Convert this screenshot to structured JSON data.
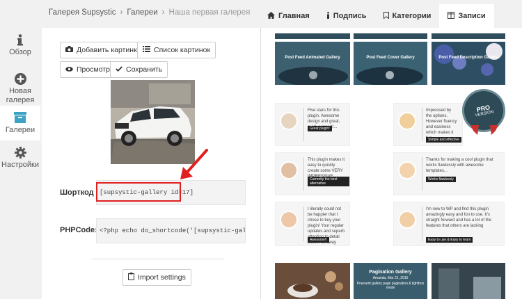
{
  "breadcrumb": {
    "root": "Галерея Supsystic",
    "section": "Галереи",
    "current": "Наша первая галерея"
  },
  "tabs": [
    {
      "label": "Главная",
      "icon": "home-icon"
    },
    {
      "label": "Подпись",
      "icon": "info-icon"
    },
    {
      "label": "Категории",
      "icon": "bookmark-icon"
    },
    {
      "label": "Записи",
      "icon": "columns-icon",
      "active": true
    }
  ],
  "sidebar": {
    "items": [
      {
        "label": "Обзор",
        "icon": "info-icon"
      },
      {
        "label": "Новая галерея",
        "icon": "plus-circle-icon"
      },
      {
        "label": "Галереи",
        "icon": "archive-icon",
        "active": true
      },
      {
        "label": "Настройки",
        "icon": "gear-icon"
      }
    ]
  },
  "toolbar": {
    "add_images": "Добавить картинки",
    "image_list": "Список картинок",
    "preview": "Просмотр",
    "save": "Сохранить"
  },
  "shortcode": {
    "label": "Шорткод",
    "value": "[supsystic-gallery id=17]"
  },
  "phpcode": {
    "label": "PHPCode:",
    "value": "<?php echo do_shortcode('[supsystic-gallery id"
  },
  "import_settings": "Import settings",
  "previews": {
    "top": [
      "Post Feed Animated Gallery",
      "Post Feed Cover Gallery",
      "Post Feed Description Gallery"
    ],
    "cards": [
      {
        "text": "Five stars for this plugin. Awesome design and great, quick support!...",
        "tag": "Great plugin!"
      },
      {
        "text": "Impressed by the options. However fluency and easiness which makes it fun",
        "tag": "Simple and effective"
      },
      {
        "text": "This plugin makes it easy to quickly create some VERY IMPRESSIVE galleries",
        "tag": "Currently the best alternative"
      },
      {
        "text": "Thanks for making a cool plugin that works flawlessly with awesome templates...",
        "tag": "Works flawlessly"
      },
      {
        "text": "I literally could not be happier that I chose to buy your plugin! Your regular updates and superb attention to detail blows me away",
        "tag": "Awesome!!"
      },
      {
        "text": "I'm new to WP and find this plugin amazingly easy and fun to use. It's straight forward and has a lot of the features that others are lacking",
        "tag": "Easy to use & Easy to learn"
      }
    ],
    "pro_badge": {
      "line1": "PRO",
      "line2": "VERSION"
    },
    "pagination": {
      "title": "Pagination Gallery",
      "meta": "Amanda, Mar 21, 2015",
      "desc": "Praesent gallery page pagination & lightbox mode"
    }
  }
}
